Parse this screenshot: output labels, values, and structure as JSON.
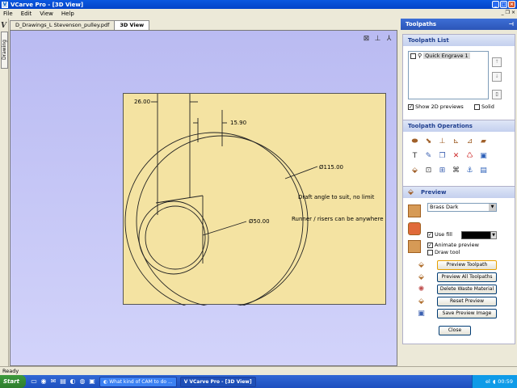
{
  "window": {
    "title": "VCarve Pro - [3D View]"
  },
  "menu": {
    "items": [
      "File",
      "Edit",
      "View",
      "Help"
    ]
  },
  "left_strip": {
    "tab_label": "Drawing"
  },
  "tabs": [
    "D_Drawings_L Stevenson_pulley.pdf",
    "3D View"
  ],
  "drawing": {
    "dim_top": "26.00",
    "dim_mid": "15.90",
    "dia_outer": "Ø115.00",
    "dia_inner": "Ø50.00",
    "note1": "Draft angle to suit, no limit",
    "note2": "Runner / risers can be anywhere"
  },
  "panel": {
    "title": "Toolpaths",
    "list_title": "Toolpath List",
    "items": [
      {
        "label": "Quick Engrave 1",
        "checked": false
      }
    ],
    "show_2d": "Show 2D previews",
    "solid": "Solid",
    "ops_title": "Toolpath Operations",
    "preview": {
      "title": "Preview",
      "material": "Brass Dark",
      "use_fill": "Use fill",
      "animate": "Animate preview",
      "draw_tool": "Draw tool",
      "buttons": [
        "Preview Toolpath",
        "Preview All Toolpaths",
        "Delete Waste Material",
        "Reset Preview",
        "Save Preview Image"
      ],
      "close": "Close"
    }
  },
  "status": {
    "text": "Ready"
  },
  "taskbar": {
    "start": "Start",
    "tasks": [
      "What kind of CAM to do ...",
      "VCarve Pro - [3D View]"
    ],
    "clock": "00:59",
    "lang": "el"
  },
  "colors": {
    "view_bg": "#c4c5f6",
    "drawing_bg": "#f4e3a2",
    "taskbar": "#245edb",
    "title_bar": "#0a58e0"
  }
}
